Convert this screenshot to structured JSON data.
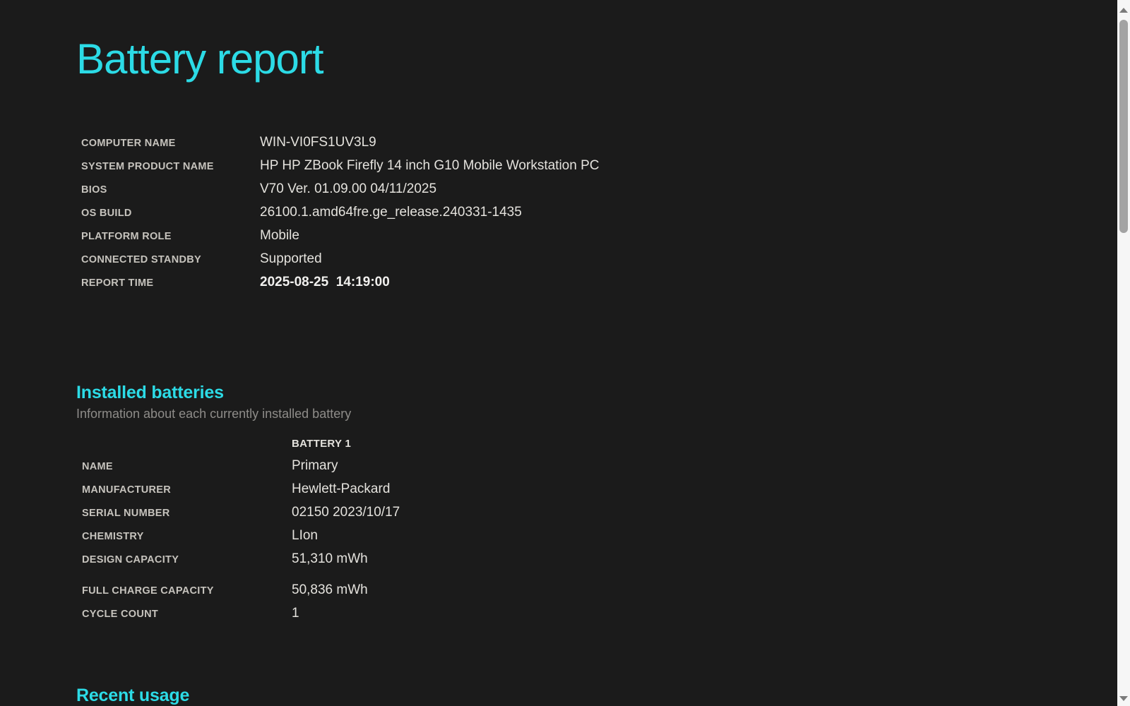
{
  "page": {
    "title": "Battery report",
    "accent_color": "#2cdbe6",
    "background_color": "#1b1b1b"
  },
  "system_info": {
    "rows": [
      {
        "label": "COMPUTER NAME",
        "value": "WIN-VI0FS1UV3L9"
      },
      {
        "label": "SYSTEM PRODUCT NAME",
        "value": "HP HP ZBook Firefly 14 inch G10 Mobile Workstation PC"
      },
      {
        "label": "BIOS",
        "value": "V70 Ver. 01.09.00 04/11/2025"
      },
      {
        "label": "OS BUILD",
        "value": "26100.1.amd64fre.ge_release.240331-1435"
      },
      {
        "label": "PLATFORM ROLE",
        "value": "Mobile"
      },
      {
        "label": "CONNECTED STANDBY",
        "value": "Supported"
      },
      {
        "label": "REPORT TIME",
        "value": "2025-08-25  14:19:00"
      }
    ]
  },
  "installed_batteries": {
    "heading": "Installed batteries",
    "subtitle": "Information about each currently installed battery",
    "column_header": "BATTERY 1",
    "rows": [
      {
        "label": "NAME",
        "value": "Primary"
      },
      {
        "label": "MANUFACTURER",
        "value": "Hewlett-Packard"
      },
      {
        "label": "SERIAL NUMBER",
        "value": "02150 2023/10/17"
      },
      {
        "label": "CHEMISTRY",
        "value": "LIon"
      },
      {
        "label": "DESIGN CAPACITY",
        "value": "51,310 mWh"
      },
      {
        "label": "FULL CHARGE CAPACITY",
        "value": "50,836 mWh"
      },
      {
        "label": "CYCLE COUNT",
        "value": "1"
      }
    ]
  },
  "recent_usage": {
    "heading": "Recent usage"
  },
  "scrollbar": {
    "track_color": "#f6f6f6",
    "thumb_color": "#a3a3a3"
  }
}
